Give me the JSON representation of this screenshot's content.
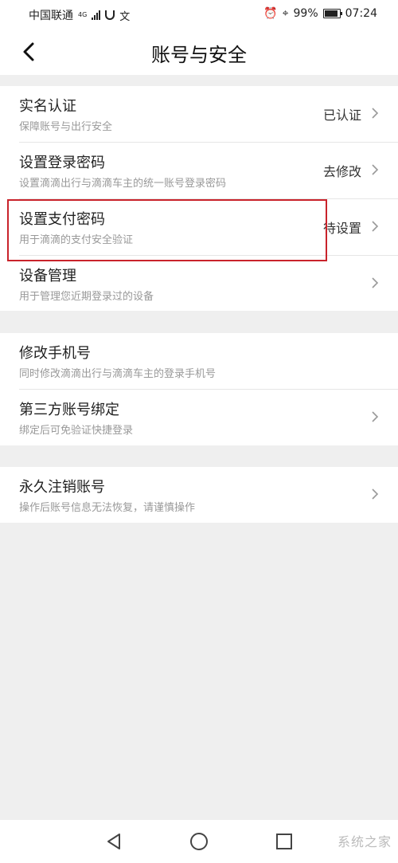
{
  "status_bar": {
    "carrier": "中国联通",
    "network": "4G",
    "battery": "99%",
    "time": "07:24"
  },
  "header": {
    "title": "账号与安全"
  },
  "groups": [
    {
      "items": [
        {
          "title": "实名认证",
          "subtitle": "保障账号与出行安全",
          "status": "已认证"
        },
        {
          "title": "设置登录密码",
          "subtitle": "设置滴滴出行与滴滴车主的统一账号登录密码",
          "status": "去修改"
        },
        {
          "title": "设置支付密码",
          "subtitle": "用于滴滴的支付安全验证",
          "status": "待设置"
        },
        {
          "title": "设备管理",
          "subtitle": "用于管理您近期登录过的设备",
          "status": ""
        }
      ]
    },
    {
      "items": [
        {
          "title": "修改手机号",
          "subtitle": "同时修改滴滴出行与滴滴车主的登录手机号",
          "status": ""
        },
        {
          "title": "第三方账号绑定",
          "subtitle": "绑定后可免验证快捷登录",
          "status": ""
        }
      ]
    },
    {
      "items": [
        {
          "title": "永久注销账号",
          "subtitle": "操作后账号信息无法恢复，请谨慎操作",
          "status": ""
        }
      ]
    }
  ],
  "watermark": "系统之家",
  "colors": {
    "highlight": "#c9232b",
    "background": "#efefef"
  }
}
